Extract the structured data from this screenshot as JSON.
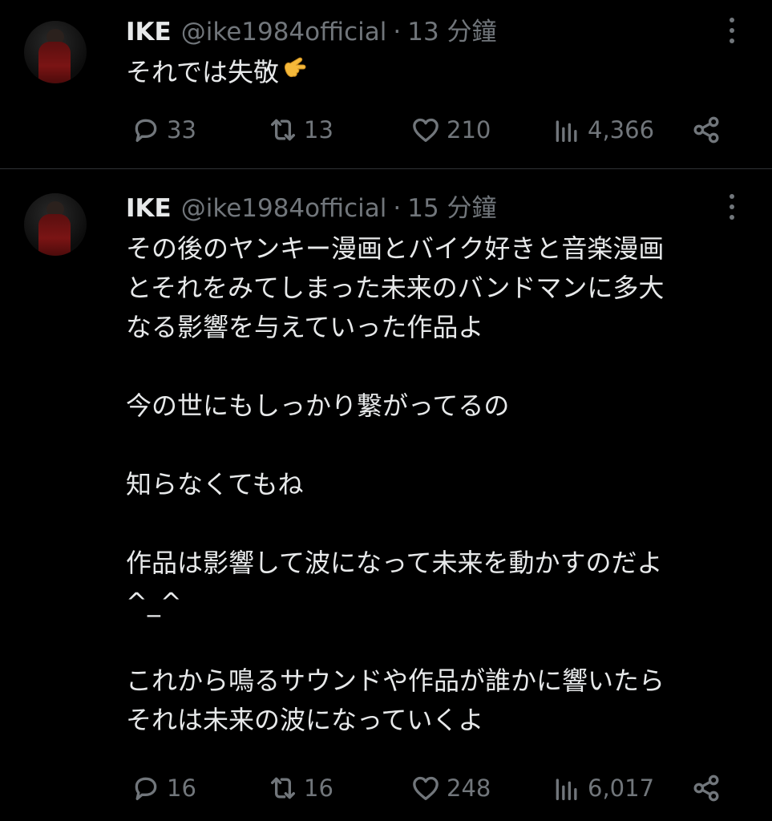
{
  "tweets": [
    {
      "name": "IKE",
      "handle": "@ike1984official",
      "separator": "·",
      "time": "13 分鐘",
      "lines": [
        "それでは失敬"
      ],
      "emoji": "🤙",
      "stats": {
        "replies": "33",
        "retweets": "13",
        "likes": "210",
        "views": "4,366"
      }
    },
    {
      "name": "IKE",
      "handle": "@ike1984official",
      "separator": "·",
      "time": "15 分鐘",
      "lines": [
        "その後のヤンキー漫画とバイク好きと音楽漫画",
        "とそれをみてしまった未来のバンドマンに多大",
        "なる影響を与えていった作品よ",
        "",
        "今の世にもしっかり繋がってるの",
        "",
        "知らなくてもね",
        "",
        "作品は影響して波になって未来を動かすのだよ",
        "^_^",
        "",
        "これから鳴るサウンドや作品が誰かに響いたら",
        "それは未来の波になっていくよ"
      ],
      "stats": {
        "replies": "16",
        "retweets": "16",
        "likes": "248",
        "views": "6,017"
      }
    }
  ],
  "icons": {
    "reply": "reply-icon",
    "retweet": "retweet-icon",
    "like": "heart-icon",
    "views": "views-icon",
    "share": "share-icon",
    "more": "more-options-icon"
  },
  "colors": {
    "background": "#000000",
    "text": "#e7e9ea",
    "secondary": "#71767b",
    "divider": "#2f3336",
    "avatar_clothing": "#7a1414"
  }
}
